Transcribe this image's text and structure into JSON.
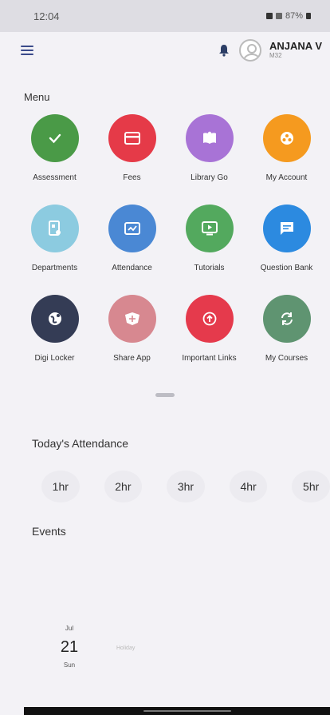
{
  "status_bar": {
    "time": "12:04",
    "battery": "87%"
  },
  "header": {
    "user_name": "ANJANA V",
    "user_id": "M32"
  },
  "menu": {
    "title": "Menu",
    "items": [
      {
        "label": "Assessment",
        "icon": "check-icon",
        "color": "#4a9a47"
      },
      {
        "label": "Fees",
        "icon": "card-icon",
        "color": "#e53a48"
      },
      {
        "label": "Library Go",
        "icon": "book-icon",
        "color": "#a873d6"
      },
      {
        "label": "My Account",
        "icon": "account-icon",
        "color": "#f59a1f"
      },
      {
        "label": "Departments",
        "icon": "department-icon",
        "color": "#8ccbe0"
      },
      {
        "label": "Attendance",
        "icon": "attendance-icon",
        "color": "#4a88d4"
      },
      {
        "label": "Tutorials",
        "icon": "play-icon",
        "color": "#53a95e"
      },
      {
        "label": "Question Bank",
        "icon": "chat-icon",
        "color": "#2c8ae0"
      },
      {
        "label": "Digi Locker",
        "icon": "locker-icon",
        "color": "#343c55"
      },
      {
        "label": "Share App",
        "icon": "share-icon",
        "color": "#d78890"
      },
      {
        "label": "Important Links",
        "icon": "link-icon",
        "color": "#e53a4c"
      },
      {
        "label": "My Courses",
        "icon": "courses-icon",
        "color": "#5f9471"
      }
    ]
  },
  "attendance": {
    "title": "Today's Attendance",
    "hours": [
      "1hr",
      "2hr",
      "3hr",
      "4hr",
      "5hr"
    ]
  },
  "events": {
    "title": "Events",
    "items": [
      {
        "month": "Jul",
        "day": "21",
        "weekday": "Sun",
        "note": "Holiday"
      }
    ]
  }
}
